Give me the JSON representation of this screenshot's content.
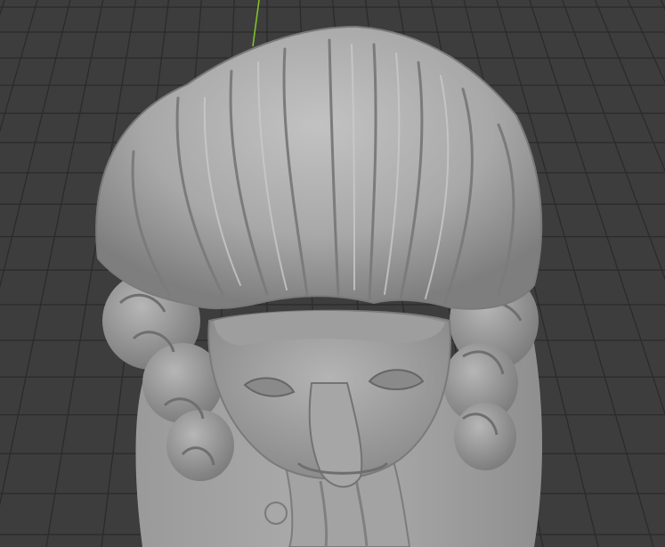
{
  "viewport": {
    "background_color": "#3d3d3d",
    "grid_color": "#2b2b2b",
    "y_axis_color": "#7fbf2a",
    "mesh_color": "#a9a9a9",
    "mesh_shadow_color": "#6f6f6f",
    "mesh_highlight_color": "#c4c4c4",
    "object": "sculpted-bust-mesh"
  }
}
